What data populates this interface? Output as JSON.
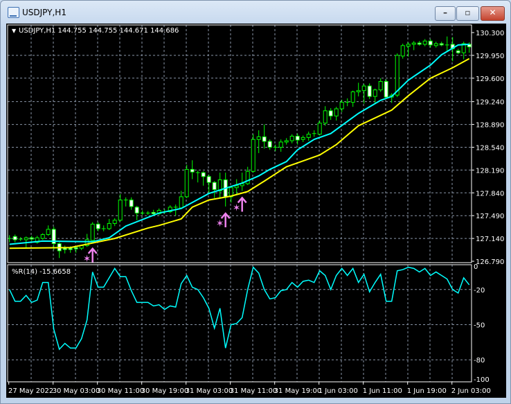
{
  "window": {
    "title": "USDJPY,H1",
    "minimize": "–",
    "maximize": "▫",
    "close": "✕"
  },
  "colors": {
    "bull": "#00ff00",
    "bear_fill": "#ffffff",
    "background": "#000000",
    "grid": "#8a96a8",
    "ma_fast": "#00ffff",
    "ma_slow": "#ffff00",
    "signal": "#ee82ee",
    "wpr": "#00ffff"
  },
  "main": {
    "header_arrow": "▼",
    "header": "USDJPY,H1  144.755 144.755 144.671 144.686",
    "price_labels": [
      "130.300",
      "129.950",
      "129.600",
      "129.240",
      "128.890",
      "128.540",
      "128.190",
      "127.840",
      "127.490",
      "127.140",
      "126.790"
    ],
    "price_range": [
      126.79,
      130.3
    ]
  },
  "indicator": {
    "label": "%R(14) -15.6658",
    "levels": [
      "0",
      "-20",
      "-50",
      "-80",
      "-100"
    ],
    "values": [
      -20,
      -30,
      -30,
      -25,
      -31,
      -29,
      -14,
      -14,
      -54,
      -71,
      -66,
      -70,
      -70,
      -62,
      -46,
      -5,
      -18,
      -18,
      -10,
      -2,
      -9,
      -9,
      -21,
      -31,
      -31,
      -31,
      -34,
      -33,
      -37,
      -34,
      -35,
      -15,
      -8,
      -18,
      -20,
      -27,
      -36,
      -53,
      -36,
      -70,
      -50,
      -49,
      -44,
      -20,
      -1,
      -6,
      -20,
      -28,
      -27,
      -21,
      -20,
      -14,
      -18,
      -13,
      -12,
      -14,
      -4,
      -8,
      -20,
      -8,
      -2,
      -8,
      -2,
      -14,
      -7,
      -22,
      -14,
      -7,
      -30,
      -30,
      -4,
      -3,
      -1,
      -2,
      -5,
      -2,
      -8,
      -5,
      -8,
      -11,
      -20,
      -23,
      -10,
      -16
    ]
  },
  "time_labels": [
    "27 May 2022",
    "30 May 03:00",
    "30 May 11:00",
    "30 May 19:00",
    "31 May 03:00",
    "31 May 11:00",
    "31 May 19:00",
    "1 Jun 03:00",
    "1 Jun 11:00",
    "1 Jun 19:00",
    "2 Jun 03:00"
  ],
  "candles_ohlc": [
    [
      127.14,
      127.19,
      127.08,
      127.14
    ],
    [
      127.17,
      127.2,
      127.08,
      127.12
    ],
    [
      127.13,
      127.16,
      127.1,
      127.13
    ],
    [
      127.12,
      127.17,
      127.0,
      127.15
    ],
    [
      127.15,
      127.18,
      127.1,
      127.13
    ],
    [
      127.08,
      127.18,
      127.06,
      127.15
    ],
    [
      127.14,
      127.22,
      127.12,
      127.2
    ],
    [
      127.2,
      127.34,
      127.18,
      127.28
    ],
    [
      127.28,
      127.32,
      126.96,
      127.06
    ],
    [
      127.06,
      127.08,
      126.84,
      126.95
    ],
    [
      126.99,
      127.03,
      126.91,
      126.97
    ],
    [
      126.99,
      127.02,
      126.92,
      126.97
    ],
    [
      127.0,
      127.03,
      126.92,
      126.98
    ],
    [
      126.99,
      127.04,
      126.96,
      127.03
    ],
    [
      127.03,
      127.21,
      127.01,
      127.12
    ],
    [
      127.11,
      127.39,
      127.09,
      127.36
    ],
    [
      127.36,
      127.39,
      127.25,
      127.29
    ],
    [
      127.29,
      127.34,
      127.25,
      127.29
    ],
    [
      127.29,
      127.44,
      127.27,
      127.37
    ],
    [
      127.37,
      127.45,
      127.33,
      127.42
    ],
    [
      127.42,
      127.82,
      127.4,
      127.73
    ],
    [
      127.73,
      127.77,
      127.63,
      127.73
    ],
    [
      127.73,
      127.77,
      127.58,
      127.63
    ],
    [
      127.62,
      127.64,
      127.42,
      127.53
    ],
    [
      127.53,
      127.57,
      127.5,
      127.53
    ],
    [
      127.53,
      127.56,
      127.5,
      127.53
    ],
    [
      127.54,
      127.58,
      127.5,
      127.52
    ],
    [
      127.52,
      127.6,
      127.5,
      127.57
    ],
    [
      127.55,
      127.59,
      127.52,
      127.55
    ],
    [
      127.55,
      127.65,
      127.53,
      127.62
    ],
    [
      127.62,
      127.66,
      127.49,
      127.62
    ],
    [
      127.61,
      127.87,
      127.59,
      127.78
    ],
    [
      127.78,
      128.27,
      127.76,
      128.2
    ],
    [
      128.2,
      128.34,
      128.05,
      128.16
    ],
    [
      128.15,
      128.18,
      128.0,
      128.15
    ],
    [
      128.15,
      128.17,
      127.95,
      128.09
    ],
    [
      128.09,
      128.12,
      127.84,
      128.0
    ],
    [
      128.0,
      128.02,
      127.76,
      127.89
    ],
    [
      127.87,
      128.15,
      127.76,
      128.04
    ],
    [
      128.04,
      128.15,
      127.63,
      127.78
    ],
    [
      127.78,
      127.95,
      127.69,
      127.92
    ],
    [
      127.92,
      128.05,
      127.8,
      127.95
    ],
    [
      127.95,
      128.15,
      127.87,
      127.98
    ],
    [
      127.98,
      128.24,
      127.96,
      128.17
    ],
    [
      128.17,
      128.74,
      128.15,
      128.66
    ],
    [
      128.66,
      128.8,
      128.45,
      128.7
    ],
    [
      128.7,
      128.89,
      128.52,
      128.63
    ],
    [
      128.63,
      128.66,
      128.5,
      128.54
    ],
    [
      128.54,
      128.58,
      128.48,
      128.54
    ],
    [
      128.54,
      128.66,
      128.47,
      128.62
    ],
    [
      128.62,
      128.68,
      128.58,
      128.64
    ],
    [
      128.64,
      128.74,
      128.6,
      128.71
    ],
    [
      128.71,
      128.75,
      128.58,
      128.65
    ],
    [
      128.66,
      128.72,
      128.62,
      128.69
    ],
    [
      128.69,
      128.78,
      128.64,
      128.74
    ],
    [
      128.74,
      128.8,
      128.7,
      128.75
    ],
    [
      128.74,
      128.95,
      128.72,
      128.91
    ],
    [
      128.91,
      129.17,
      128.87,
      129.1
    ],
    [
      129.1,
      129.14,
      128.96,
      129.02
    ],
    [
      129.02,
      129.16,
      128.95,
      129.13
    ],
    [
      129.13,
      129.27,
      129.08,
      129.23
    ],
    [
      129.23,
      129.29,
      129.17,
      129.23
    ],
    [
      129.23,
      129.41,
      129.16,
      129.39
    ],
    [
      129.39,
      129.53,
      129.32,
      129.41
    ],
    [
      129.41,
      129.51,
      129.21,
      129.48
    ],
    [
      129.48,
      129.52,
      129.28,
      129.32
    ],
    [
      129.32,
      129.44,
      129.22,
      129.42
    ],
    [
      129.42,
      129.6,
      129.39,
      129.55
    ],
    [
      129.55,
      129.58,
      129.29,
      129.31
    ],
    [
      129.31,
      129.37,
      129.22,
      129.34
    ],
    [
      129.34,
      129.98,
      129.31,
      129.95
    ],
    [
      129.94,
      130.13,
      129.9,
      130.1
    ],
    [
      130.09,
      130.15,
      129.93,
      130.12
    ],
    [
      130.12,
      130.17,
      130.03,
      130.14
    ],
    [
      130.14,
      130.17,
      130.1,
      130.12
    ],
    [
      130.12,
      130.2,
      130.09,
      130.17
    ],
    [
      130.17,
      130.2,
      130.07,
      130.11
    ],
    [
      130.1,
      130.16,
      130.07,
      130.13
    ],
    [
      130.13,
      130.16,
      130.09,
      130.11
    ],
    [
      130.11,
      130.24,
      130.02,
      130.11
    ],
    [
      130.12,
      130.23,
      129.86,
      130.05
    ],
    [
      130.02,
      130.05,
      129.97,
      129.99
    ],
    [
      129.99,
      130.16,
      129.89,
      130.13
    ],
    [
      130.12,
      130.15,
      129.99,
      130.08
    ]
  ],
  "ma_fast": [
    [
      0,
      127.05
    ],
    [
      6,
      127.1
    ],
    [
      15,
      127.09
    ],
    [
      18,
      127.15
    ],
    [
      21,
      127.33
    ],
    [
      27,
      127.53
    ],
    [
      31,
      127.6
    ],
    [
      36,
      127.83
    ],
    [
      42,
      127.99
    ],
    [
      45,
      128.1
    ],
    [
      47,
      128.2
    ],
    [
      50,
      128.32
    ],
    [
      52,
      128.5
    ],
    [
      55,
      128.66
    ],
    [
      58,
      128.75
    ],
    [
      63,
      129.06
    ],
    [
      67,
      129.26
    ],
    [
      69,
      129.32
    ],
    [
      72,
      129.57
    ],
    [
      76,
      129.8
    ],
    [
      78,
      129.96
    ],
    [
      81,
      130.11
    ],
    [
      83,
      130.12
    ]
  ],
  "ma_slow": [
    [
      0,
      126.99
    ],
    [
      11,
      127.0
    ],
    [
      15,
      127.07
    ],
    [
      19,
      127.14
    ],
    [
      25,
      127.3
    ],
    [
      27,
      127.34
    ],
    [
      31,
      127.44
    ],
    [
      33,
      127.62
    ],
    [
      36,
      127.73
    ],
    [
      40,
      127.79
    ],
    [
      43,
      127.86
    ],
    [
      46,
      128.02
    ],
    [
      50,
      128.24
    ],
    [
      52,
      128.3
    ],
    [
      56,
      128.42
    ],
    [
      59,
      128.58
    ],
    [
      63,
      128.87
    ],
    [
      69,
      129.11
    ],
    [
      72,
      129.33
    ],
    [
      76,
      129.6
    ],
    [
      80,
      129.76
    ],
    [
      83,
      129.9
    ]
  ],
  "buy_signals": [
    15,
    39,
    42
  ]
}
